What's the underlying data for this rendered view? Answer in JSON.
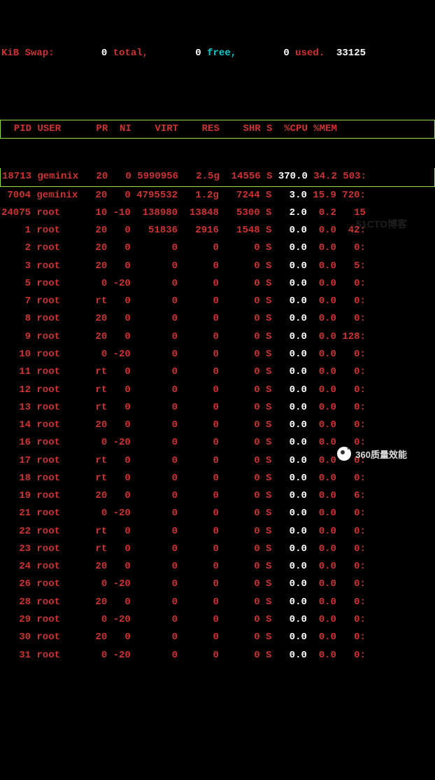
{
  "swap": {
    "label": "KiB Swap:",
    "total_val": "0",
    "total_lbl": "total,",
    "free_val": "0",
    "free_lbl": "free,",
    "used_val": "0",
    "used_lbl": "used.",
    "avail": "33125"
  },
  "columns": {
    "pid": "PID",
    "user": "USER",
    "pr": "PR",
    "ni": "NI",
    "virt": "VIRT",
    "res": "RES",
    "shr": "SHR",
    "s": "S",
    "cpu": "%CPU",
    "mem": "%MEM"
  },
  "rows": [
    {
      "pid": "18713",
      "user": "geminix",
      "pr": "20",
      "ni": "0",
      "virt": "5990956",
      "res": "2.5g",
      "shr": "14556",
      "s": "S",
      "cpu": "370.0",
      "mem": "34.2",
      "time": "503:",
      "hl": true
    },
    {
      "pid": "7004",
      "user": "geminix",
      "pr": "20",
      "ni": "0",
      "virt": "4795532",
      "res": "1.2g",
      "shr": "7244",
      "s": "S",
      "cpu": "3.0",
      "mem": "15.9",
      "time": "720:"
    },
    {
      "pid": "24075",
      "user": "root",
      "pr": "10",
      "ni": "-10",
      "virt": "138980",
      "res": "13848",
      "shr": "5300",
      "s": "S",
      "cpu": "2.0",
      "mem": "0.2",
      "time": "15"
    },
    {
      "pid": "1",
      "user": "root",
      "pr": "20",
      "ni": "0",
      "virt": "51836",
      "res": "2916",
      "shr": "1548",
      "s": "S",
      "cpu": "0.0",
      "mem": "0.0",
      "time": "42:"
    },
    {
      "pid": "2",
      "user": "root",
      "pr": "20",
      "ni": "0",
      "virt": "0",
      "res": "0",
      "shr": "0",
      "s": "S",
      "cpu": "0.0",
      "mem": "0.0",
      "time": "0:"
    },
    {
      "pid": "3",
      "user": "root",
      "pr": "20",
      "ni": "0",
      "virt": "0",
      "res": "0",
      "shr": "0",
      "s": "S",
      "cpu": "0.0",
      "mem": "0.0",
      "time": "5:"
    },
    {
      "pid": "5",
      "user": "root",
      "pr": "0",
      "ni": "-20",
      "virt": "0",
      "res": "0",
      "shr": "0",
      "s": "S",
      "cpu": "0.0",
      "mem": "0.0",
      "time": "0:"
    },
    {
      "pid": "7",
      "user": "root",
      "pr": "rt",
      "ni": "0",
      "virt": "0",
      "res": "0",
      "shr": "0",
      "s": "S",
      "cpu": "0.0",
      "mem": "0.0",
      "time": "0:"
    },
    {
      "pid": "8",
      "user": "root",
      "pr": "20",
      "ni": "0",
      "virt": "0",
      "res": "0",
      "shr": "0",
      "s": "S",
      "cpu": "0.0",
      "mem": "0.0",
      "time": "0:"
    },
    {
      "pid": "9",
      "user": "root",
      "pr": "20",
      "ni": "0",
      "virt": "0",
      "res": "0",
      "shr": "0",
      "s": "S",
      "cpu": "0.0",
      "mem": "0.0",
      "time": "128:"
    },
    {
      "pid": "10",
      "user": "root",
      "pr": "0",
      "ni": "-20",
      "virt": "0",
      "res": "0",
      "shr": "0",
      "s": "S",
      "cpu": "0.0",
      "mem": "0.0",
      "time": "0:"
    },
    {
      "pid": "11",
      "user": "root",
      "pr": "rt",
      "ni": "0",
      "virt": "0",
      "res": "0",
      "shr": "0",
      "s": "S",
      "cpu": "0.0",
      "mem": "0.0",
      "time": "0:"
    },
    {
      "pid": "12",
      "user": "root",
      "pr": "rt",
      "ni": "0",
      "virt": "0",
      "res": "0",
      "shr": "0",
      "s": "S",
      "cpu": "0.0",
      "mem": "0.0",
      "time": "0:"
    },
    {
      "pid": "13",
      "user": "root",
      "pr": "rt",
      "ni": "0",
      "virt": "0",
      "res": "0",
      "shr": "0",
      "s": "S",
      "cpu": "0.0",
      "mem": "0.0",
      "time": "0:"
    },
    {
      "pid": "14",
      "user": "root",
      "pr": "20",
      "ni": "0",
      "virt": "0",
      "res": "0",
      "shr": "0",
      "s": "S",
      "cpu": "0.0",
      "mem": "0.0",
      "time": "0:"
    },
    {
      "pid": "16",
      "user": "root",
      "pr": "0",
      "ni": "-20",
      "virt": "0",
      "res": "0",
      "shr": "0",
      "s": "S",
      "cpu": "0.0",
      "mem": "0.0",
      "time": "0:"
    },
    {
      "pid": "17",
      "user": "root",
      "pr": "rt",
      "ni": "0",
      "virt": "0",
      "res": "0",
      "shr": "0",
      "s": "S",
      "cpu": "0.0",
      "mem": "0.0",
      "time": "0:"
    },
    {
      "pid": "18",
      "user": "root",
      "pr": "rt",
      "ni": "0",
      "virt": "0",
      "res": "0",
      "shr": "0",
      "s": "S",
      "cpu": "0.0",
      "mem": "0.0",
      "time": "0:"
    },
    {
      "pid": "19",
      "user": "root",
      "pr": "20",
      "ni": "0",
      "virt": "0",
      "res": "0",
      "shr": "0",
      "s": "S",
      "cpu": "0.0",
      "mem": "0.0",
      "time": "6:"
    },
    {
      "pid": "21",
      "user": "root",
      "pr": "0",
      "ni": "-20",
      "virt": "0",
      "res": "0",
      "shr": "0",
      "s": "S",
      "cpu": "0.0",
      "mem": "0.0",
      "time": "0:"
    },
    {
      "pid": "22",
      "user": "root",
      "pr": "rt",
      "ni": "0",
      "virt": "0",
      "res": "0",
      "shr": "0",
      "s": "S",
      "cpu": "0.0",
      "mem": "0.0",
      "time": "0:"
    },
    {
      "pid": "23",
      "user": "root",
      "pr": "rt",
      "ni": "0",
      "virt": "0",
      "res": "0",
      "shr": "0",
      "s": "S",
      "cpu": "0.0",
      "mem": "0.0",
      "time": "0:"
    },
    {
      "pid": "24",
      "user": "root",
      "pr": "20",
      "ni": "0",
      "virt": "0",
      "res": "0",
      "shr": "0",
      "s": "S",
      "cpu": "0.0",
      "mem": "0.0",
      "time": "0:"
    },
    {
      "pid": "26",
      "user": "root",
      "pr": "0",
      "ni": "-20",
      "virt": "0",
      "res": "0",
      "shr": "0",
      "s": "S",
      "cpu": "0.0",
      "mem": "0.0",
      "time": "0:"
    },
    {
      "pid": "28",
      "user": "root",
      "pr": "20",
      "ni": "0",
      "virt": "0",
      "res": "0",
      "shr": "0",
      "s": "S",
      "cpu": "0.0",
      "mem": "0.0",
      "time": "0:"
    },
    {
      "pid": "29",
      "user": "root",
      "pr": "0",
      "ni": "-20",
      "virt": "0",
      "res": "0",
      "shr": "0",
      "s": "S",
      "cpu": "0.0",
      "mem": "0.0",
      "time": "0:"
    },
    {
      "pid": "30",
      "user": "root",
      "pr": "20",
      "ni": "0",
      "virt": "0",
      "res": "0",
      "shr": "0",
      "s": "S",
      "cpu": "0.0",
      "mem": "0.0",
      "time": "0:"
    },
    {
      "pid": "31",
      "user": "root",
      "pr": "0",
      "ni": "-20",
      "virt": "0",
      "res": "0",
      "shr": "0",
      "s": "S",
      "cpu": "0.0",
      "mem": "0.0",
      "time": "0:"
    }
  ],
  "watermark": "51CTO博客",
  "brand": "360质量效能"
}
